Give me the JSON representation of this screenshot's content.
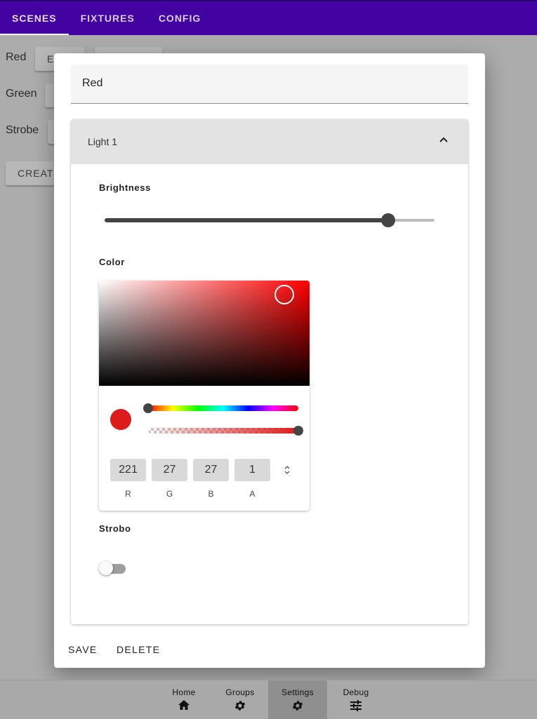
{
  "topbar": {
    "tabs": [
      {
        "label": "SCENES"
      },
      {
        "label": "FIXTURES"
      },
      {
        "label": "CONFIG"
      }
    ]
  },
  "background": {
    "rows": [
      {
        "label": "Red",
        "button": "E"
      },
      {
        "label": "Green"
      },
      {
        "label": "Strobe"
      }
    ],
    "create_button": "CREAT"
  },
  "dialog": {
    "name_value": "Red",
    "panel_title": "Light 1",
    "brightness_label": "Brightness",
    "brightness_value": 0.86,
    "color_label": "Color",
    "color": {
      "r": "221",
      "g": "27",
      "b": "27",
      "a": "1",
      "r_label": "R",
      "g_label": "G",
      "b_label": "B",
      "a_label": "A",
      "swatch_hex": "#dd1b1b",
      "hue_fraction": 0.0,
      "alpha_fraction": 1.0,
      "saturation": 0.88,
      "value": 0.87
    },
    "strobo_label": "Strobo",
    "strobo_on": false,
    "save_label": "SAVE",
    "delete_label": "DELETE"
  },
  "bottomnav": {
    "items": [
      {
        "label": "Home",
        "icon": "home-icon"
      },
      {
        "label": "Groups",
        "icon": "gear-icon"
      },
      {
        "label": "Settings",
        "icon": "gear-icon"
      },
      {
        "label": "Debug",
        "icon": "tune-icon"
      }
    ],
    "active_index": 2
  },
  "colors": {
    "appbar": "#4303a3",
    "overlay_bg": "#acacac",
    "accent_dark": "#444444"
  }
}
